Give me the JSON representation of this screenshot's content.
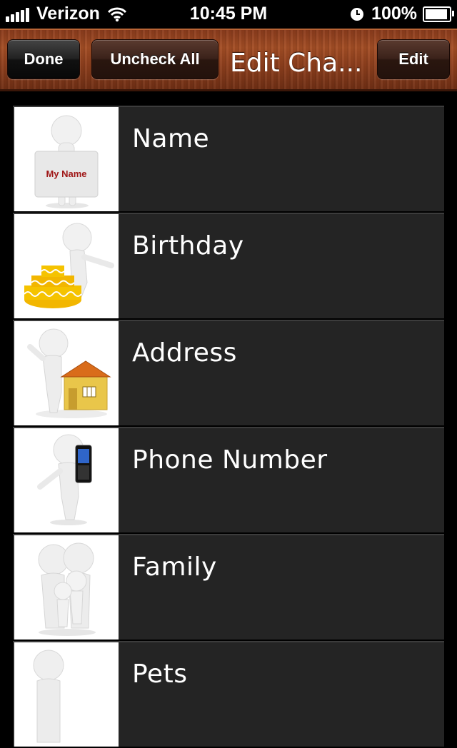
{
  "status_bar": {
    "carrier": "Verizon",
    "time": "10:45 PM",
    "battery": "100%",
    "battery_level": 100,
    "icons": [
      "signal-icon",
      "wifi-icon",
      "clock-icon",
      "battery-icon"
    ]
  },
  "nav": {
    "done_label": "Done",
    "uncheck_label": "Uncheck All",
    "title": "Edit Cha...",
    "edit_label": "Edit"
  },
  "items": [
    {
      "label": "Name",
      "icon": "name-sign-figure-icon",
      "sign_text": "My Name"
    },
    {
      "label": "Birthday",
      "icon": "birthday-cake-figure-icon"
    },
    {
      "label": "Address",
      "icon": "house-figure-icon"
    },
    {
      "label": "Phone Number",
      "icon": "phone-figure-icon"
    },
    {
      "label": "Family",
      "icon": "family-figure-icon"
    },
    {
      "label": "Pets",
      "icon": "pets-figure-icon"
    }
  ],
  "colors": {
    "wood": "#8a3b1c",
    "row_bg": "#242424",
    "cake_yellow": "#f2b600",
    "house_yellow": "#e9c64a",
    "roof_orange": "#d96c1a",
    "sign_text_red": "#a01818"
  }
}
